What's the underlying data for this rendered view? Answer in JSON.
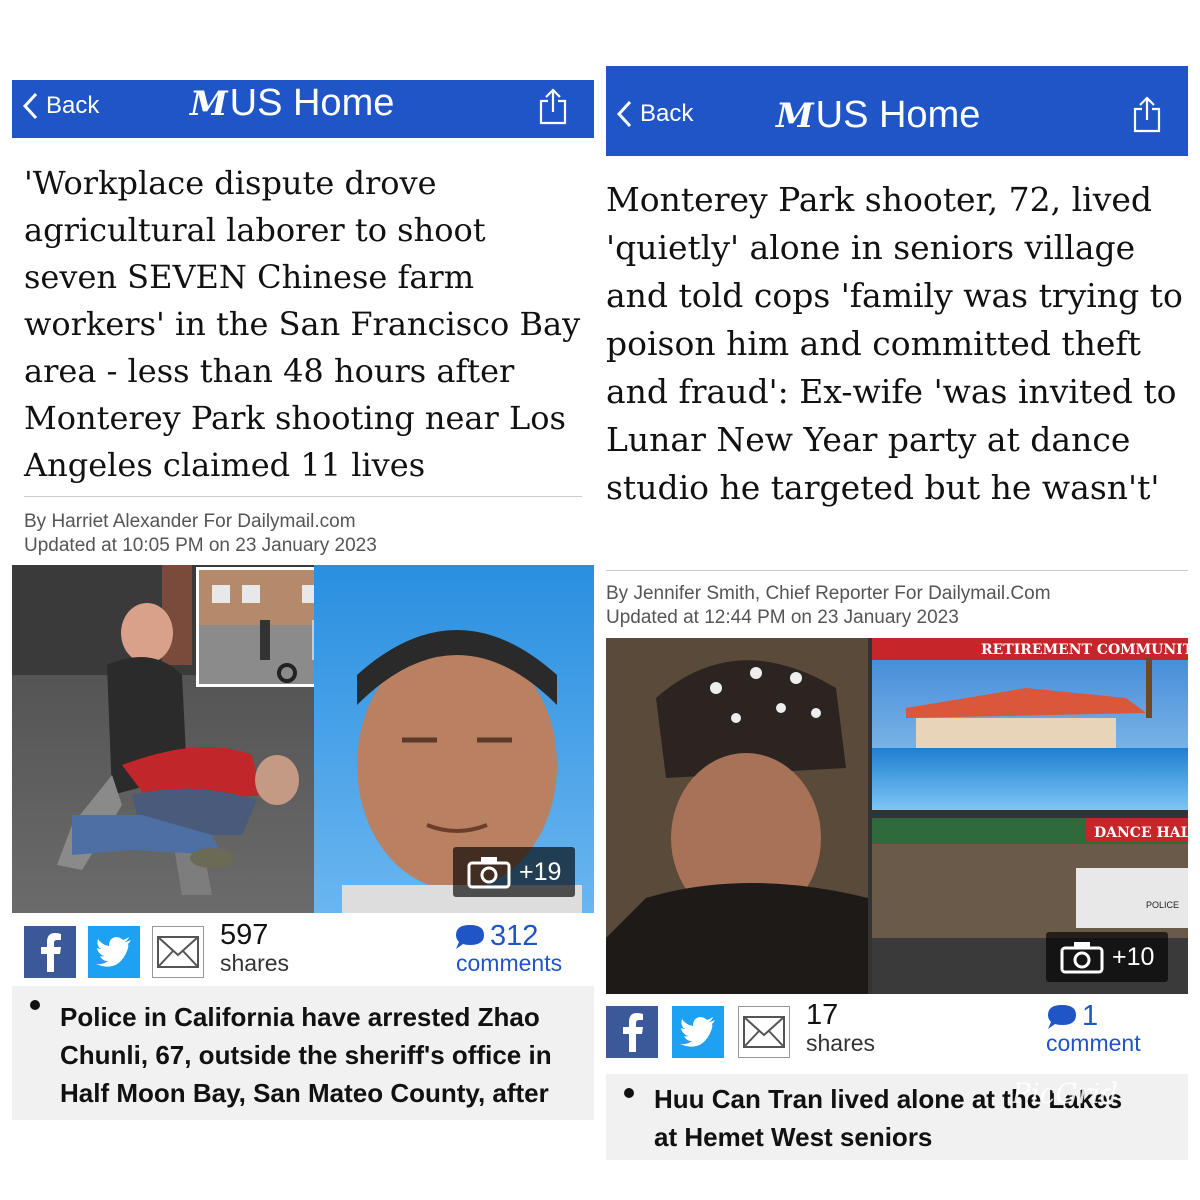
{
  "colors": {
    "nav": "#1f55c6",
    "facebook": "#3b5998",
    "twitter": "#1da1f2",
    "comment_link": "#1f55c6"
  },
  "left": {
    "nav": {
      "back_label": "Back",
      "logo": "M",
      "home_label": "US Home"
    },
    "headline": "'Workplace dispute drove agricultural laborer to shoot seven SEVEN Chinese farm workers' in the San Francisco Bay area - less than 48 hours after Monterey Park shooting near Los Angeles claimed 11 lives",
    "byline": "By Harriet Alexander For Dailymail.com",
    "updated": "Updated at 10:05 PM on 23 January 2023",
    "photo_count": "+19",
    "shares_count": "597",
    "shares_label": "shares",
    "comments_count": "312",
    "comments_label": "comments",
    "bullet": "Police in California have arrested Zhao Chunli, 67, outside the sheriff's office in Half Moon Bay, San Mateo County, after the mass"
  },
  "right": {
    "nav": {
      "back_label": "Back",
      "logo": "M",
      "home_label": "US Home"
    },
    "headline": "Monterey Park shooter, 72, lived 'quietly' alone in seniors village and told cops 'family was trying to poison him and committed theft and fraud': Ex-wife 'was invited to Lunar New Year party at dance studio he targeted but he wasn't'",
    "byline": "By Jennifer Smith, Chief Reporter For Dailymail.Com",
    "updated": "Updated at 12:44 PM on 23 January 2023",
    "photo_label_1": "RETIREMENT COMMUNITY",
    "photo_label_2": "DANCE HALL",
    "police_label": "POLICE",
    "photo_count": "+10",
    "shares_count": "17",
    "shares_label": "shares",
    "comments_count": "1",
    "comments_label": "comment",
    "bullet": "Huu Can Tran lived alone at the Lakes at Hemet West seniors",
    "watermark": "PicGrid"
  }
}
